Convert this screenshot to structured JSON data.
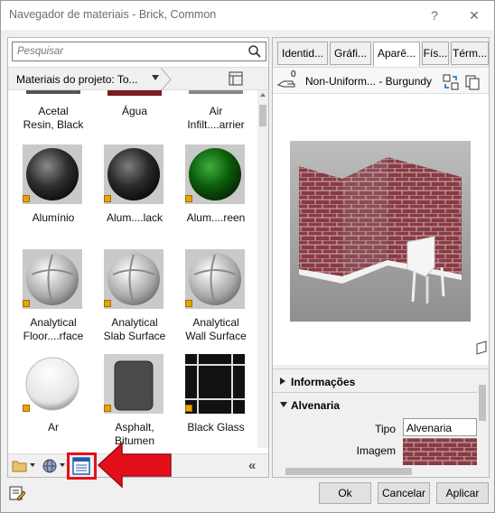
{
  "window": {
    "title": "Navegador de materiais - Brick, Common",
    "help_label": "?",
    "close_label": "✕"
  },
  "browser": {
    "search_placeholder": "Pesquisar",
    "breadcrumb": "Materiais do projeto: To...",
    "materials": [
      {
        "label1": "Acetal",
        "label2": "Resin, Black"
      },
      {
        "label1": "Água",
        "label2": ""
      },
      {
        "label1": "Air",
        "label2": "Infilt....arrier"
      },
      {
        "label1": "Alumínio",
        "label2": ""
      },
      {
        "label1": "Alum....lack",
        "label2": ""
      },
      {
        "label1": "Alum....reen",
        "label2": ""
      },
      {
        "label1": "Analytical",
        "label2": "Floor....rface"
      },
      {
        "label1": "Analytical",
        "label2": "Slab Surface"
      },
      {
        "label1": "Analytical",
        "label2": "Wall Surface"
      },
      {
        "label1": "Ar",
        "label2": ""
      },
      {
        "label1": "Asphalt,",
        "label2": "Bitumen"
      },
      {
        "label1": "Black Glass",
        "label2": ""
      }
    ],
    "collapse_label": "«"
  },
  "editor": {
    "tabs": [
      "Identid...",
      "Gráfi...",
      "Aparê...",
      "Fís...",
      "Térm..."
    ],
    "active_tab": 2,
    "asset_count": "0",
    "asset_name": "Non-Uniform... - Burgundy",
    "sections": {
      "info": "Informações",
      "masonry": "Alvenaria"
    },
    "fields": {
      "type_label": "Tipo",
      "type_value": "Alvenaria",
      "image_label": "Imagem"
    }
  },
  "footer": {
    "ok": "Ok",
    "cancel": "Cancelar",
    "apply": "Aplicar"
  },
  "colors": {
    "annotation": "#e3101b",
    "brick": "#8a3a45"
  },
  "icons": [
    "search-icon",
    "chevron-down-icon",
    "view-toggle-icon",
    "asset-hand-icon",
    "replace-asset-icon",
    "duplicate-asset-icon",
    "warning-icon",
    "folder-icon",
    "globe-icon",
    "material-editor-icon",
    "collapse-icon",
    "edit-icon",
    "red-arrow-icon"
  ]
}
